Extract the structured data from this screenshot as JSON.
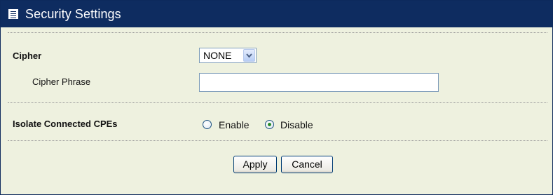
{
  "header": {
    "title": "Security Settings",
    "icon": "list-icon"
  },
  "form": {
    "cipher": {
      "label": "Cipher",
      "selected": "NONE"
    },
    "cipher_phrase": {
      "label": "Cipher Phrase",
      "value": ""
    },
    "isolate": {
      "label": "Isolate Connected CPEs",
      "options": [
        {
          "label": "Enable",
          "checked": false
        },
        {
          "label": "Disable",
          "checked": true
        }
      ]
    }
  },
  "buttons": {
    "apply": "Apply",
    "cancel": "Cancel"
  },
  "colors": {
    "header_bg": "#0e2c60",
    "panel_bg": "#eef1df"
  }
}
